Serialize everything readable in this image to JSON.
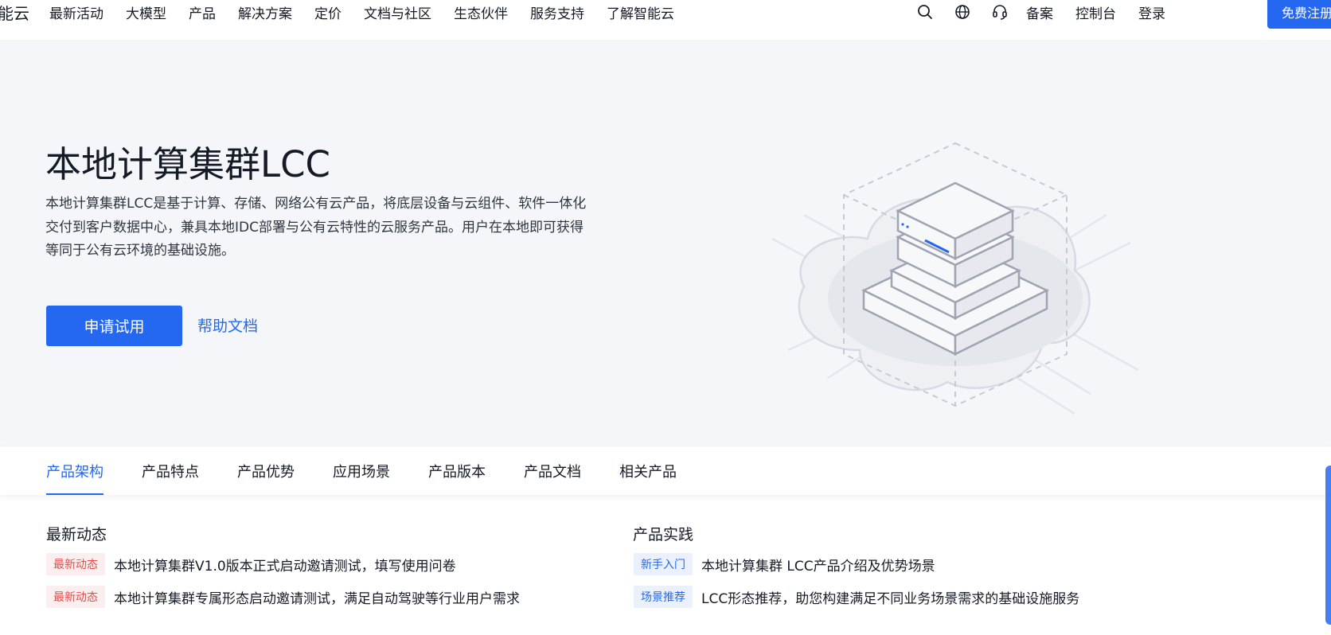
{
  "nav": {
    "brand_fragment": "能云",
    "links": [
      "最新活动",
      "大模型",
      "产品",
      "解决方案",
      "定价",
      "文档与社区",
      "生态伙伴",
      "服务支持",
      "了解智能云"
    ],
    "right_links": {
      "record": "备案",
      "console": "控制台",
      "login": "登录"
    },
    "signup": "免费注册",
    "icons": [
      "search-icon",
      "globe-icon",
      "headset-icon"
    ]
  },
  "hero": {
    "title": "本地计算集群LCC",
    "description": "本地计算集群LCC是基于计算、存储、网络公有云产品，将底层设备与云组件、软件一体化交付到客户数据中心，兼具本地IDC部署与公有云特性的云服务产品。用户在本地即可获得等同于公有云环境的基础设施。",
    "apply_button": "申请试用",
    "help_link": "帮助文档"
  },
  "tabs": {
    "items": [
      "产品架构",
      "产品特点",
      "产品优势",
      "应用场景",
      "产品版本",
      "产品文档",
      "相关产品"
    ],
    "active": "产品架构"
  },
  "news": {
    "left": {
      "title": "最新动态",
      "items": [
        {
          "badge": "最新动态",
          "text": "本地计算集群V1.0版本正式启动邀请测试，填写使用问卷"
        },
        {
          "badge": "最新动态",
          "text": "本地计算集群专属形态启动邀请测试，满足自动驾驶等行业用户需求"
        }
      ]
    },
    "right": {
      "title": "产品实践",
      "items": [
        {
          "badge": "新手入门",
          "text": "本地计算集群 LCC产品介绍及优势场景"
        },
        {
          "badge": "场景推荐",
          "text": "LCC形态推荐，助您构建满足不同业务场景需求的基础设施服务"
        }
      ]
    }
  },
  "colors": {
    "accent": "#2468f2",
    "hero_bg": "#f4f6f9",
    "badge_red": "#e84c4c"
  }
}
